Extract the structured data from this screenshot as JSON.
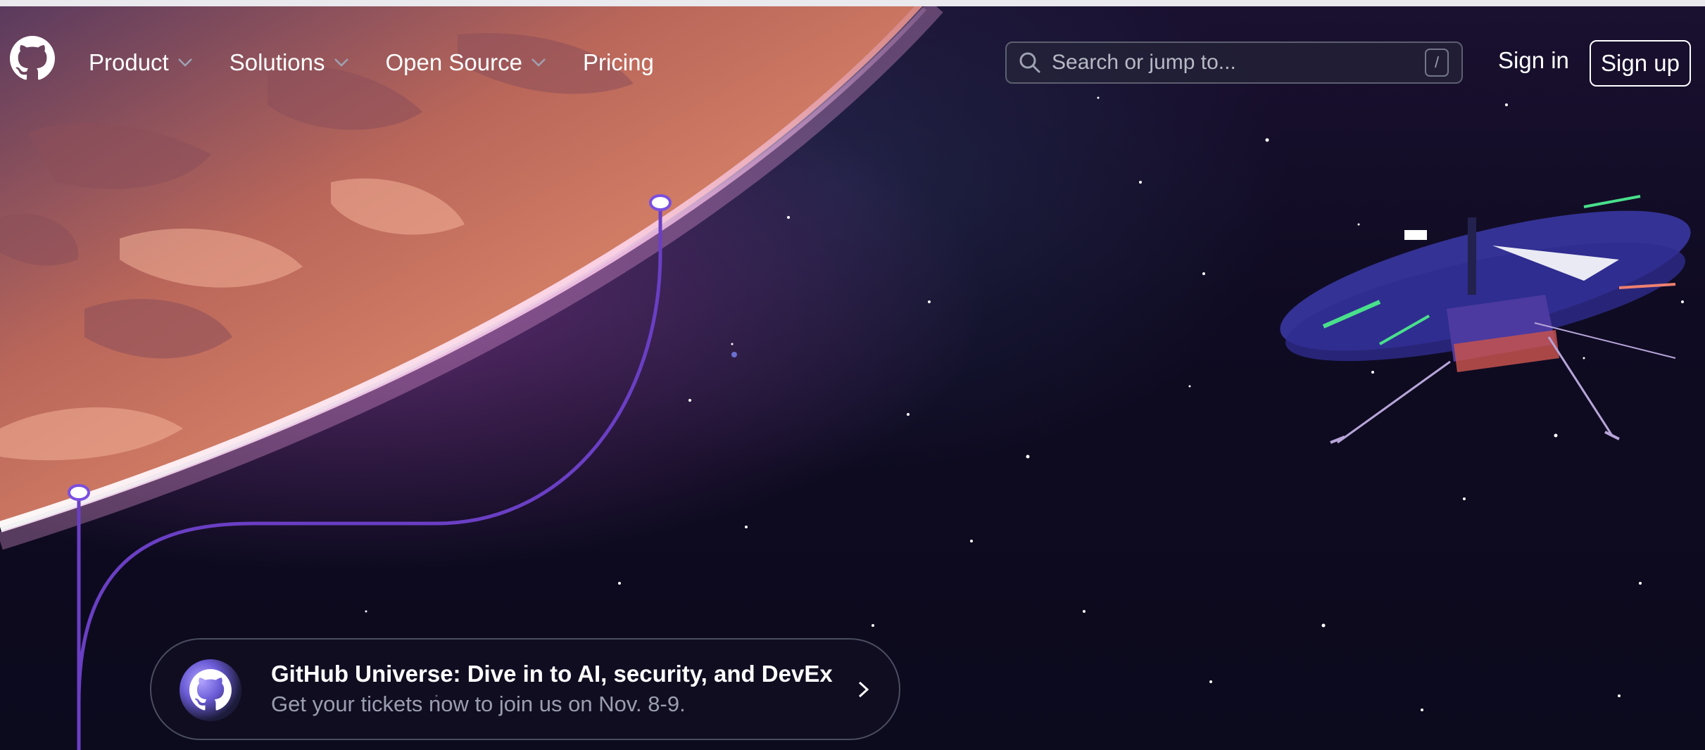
{
  "header": {
    "nav": [
      {
        "label": "Product",
        "has_dropdown": true
      },
      {
        "label": "Solutions",
        "has_dropdown": true
      },
      {
        "label": "Open Source",
        "has_dropdown": true
      },
      {
        "label": "Pricing",
        "has_dropdown": false
      }
    ],
    "search": {
      "placeholder": "Search or jump to...",
      "shortcut": "/"
    },
    "sign_in": "Sign in",
    "sign_up": "Sign up"
  },
  "banner": {
    "title": "GitHub Universe: Dive in to AI, security, and DevEx",
    "subtitle": "Get your tickets now to join us on Nov. 8-9."
  },
  "icons": {
    "logo": "github-mark-icon",
    "search": "search-icon",
    "chevron": "chevron-down-icon",
    "arrow": "chevron-right-icon"
  },
  "colors": {
    "background": "#0d0a1c",
    "accent_line": "#6e40c9",
    "planet": "#d77a5e"
  }
}
